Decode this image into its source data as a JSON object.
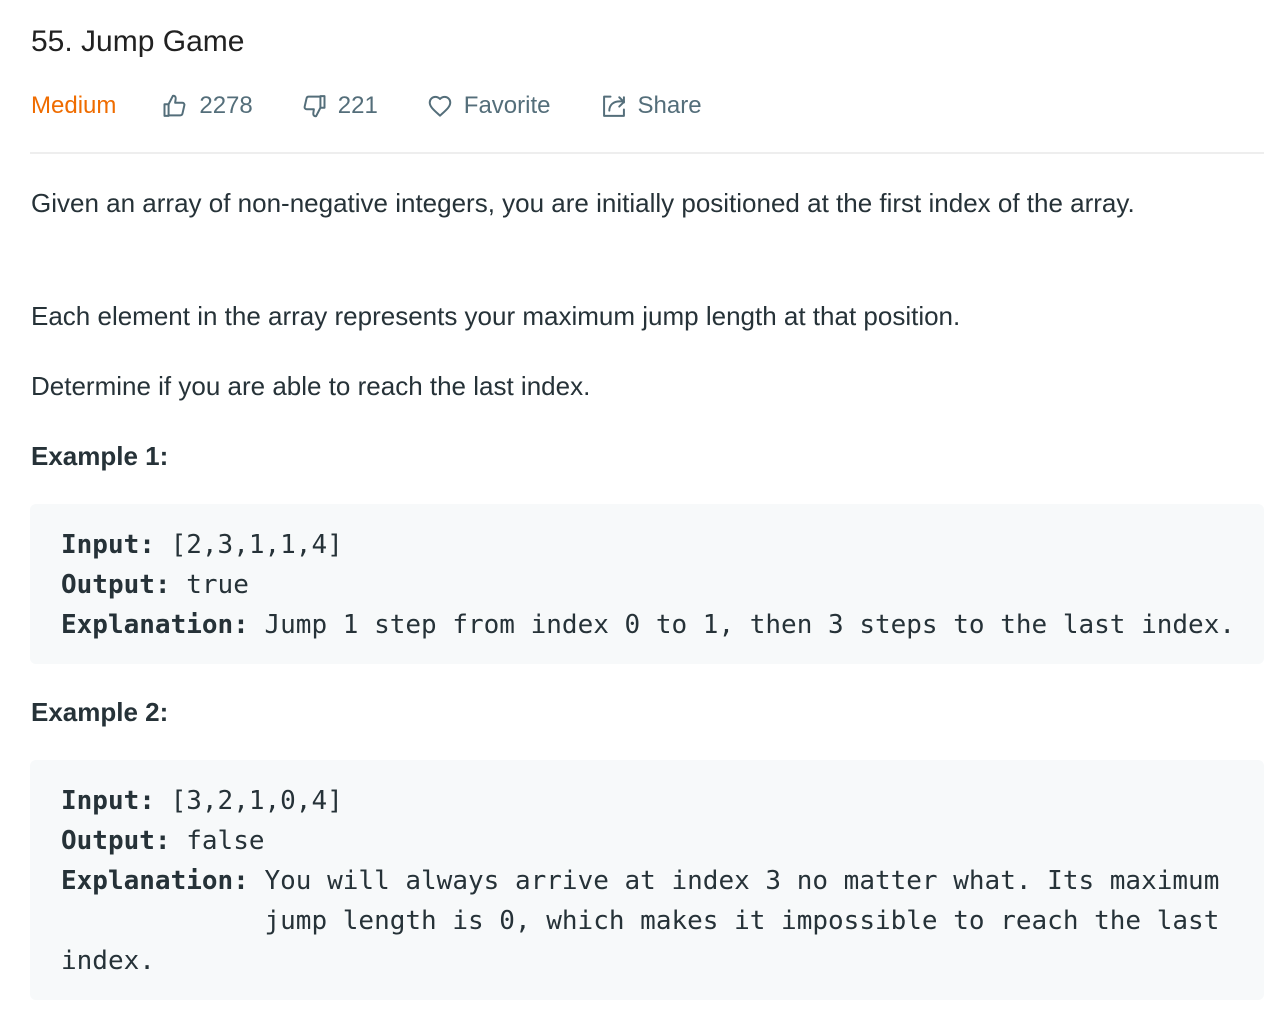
{
  "problem": {
    "title": "55. Jump Game",
    "difficulty": "Medium",
    "likes": "2278",
    "dislikes": "221",
    "favorite_label": "Favorite",
    "share_label": "Share"
  },
  "description": {
    "paragraph_1": "Given an array of non-negative integers, you are initially positioned at the first index of the array.",
    "paragraph_2": "Each element in the array represents your maximum jump length at that position.",
    "paragraph_3": "Determine if you are able to reach the last index."
  },
  "examples": [
    {
      "heading": "Example 1:",
      "input_label": "Input:",
      "input_value": " [2,3,1,1,4]",
      "output_label": "Output:",
      "output_value": " true",
      "explanation_label": "Explanation:",
      "explanation_lines": [
        " Jump 1 step from index 0 to 1, then 3 steps to the last index."
      ]
    },
    {
      "heading": "Example 2:",
      "input_label": "Input:",
      "input_value": " [3,2,1,0,4]",
      "output_label": "Output:",
      "output_value": " false",
      "explanation_label": "Explanation:",
      "explanation_lines": [
        " You will always arrive at index 3 no matter what. Its maximum",
        "             jump length is 0, which makes it impossible to reach the last",
        "index."
      ]
    }
  ],
  "colors": {
    "difficulty_medium": "#ef6c00",
    "meta_text": "#546e7a",
    "code_background": "#f7f9fa",
    "divider": "#eeeeee"
  },
  "icons": {
    "like": "thumbs-up-icon",
    "dislike": "thumbs-down-icon",
    "favorite": "heart-icon",
    "share": "share-icon"
  }
}
